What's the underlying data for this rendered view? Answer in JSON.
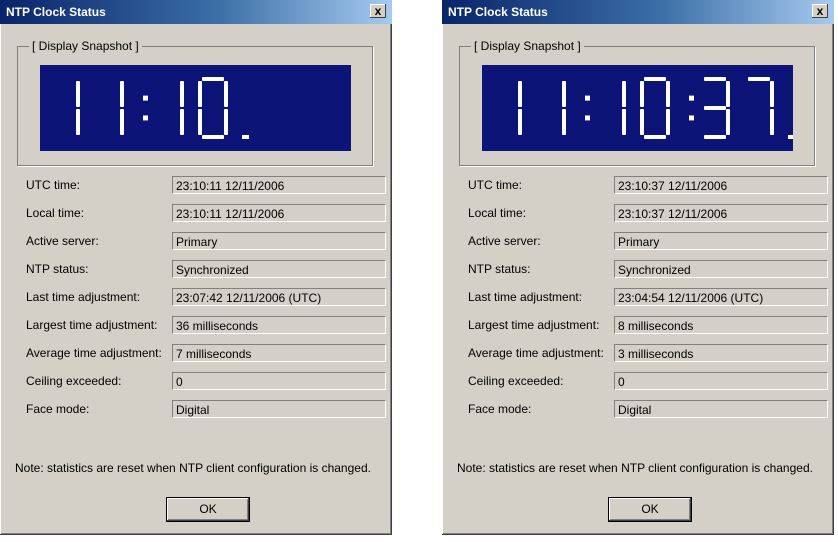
{
  "colors": {
    "display_bg": "#0c1478",
    "segment": "#ffffff",
    "title_bar": "#0a246a"
  },
  "windows": [
    {
      "title": "NTP Clock Status",
      "close_label": "x",
      "group_label": "[ Display Snapshot ]",
      "clock": {
        "hours": "11",
        "minutes": "10",
        "seconds": ""
      },
      "fields": [
        {
          "label": "UTC time:",
          "value": "23:10:11 12/11/2006"
        },
        {
          "label": "Local time:",
          "value": "23:10:11 12/11/2006"
        },
        {
          "label": "Active server:",
          "value": "Primary"
        },
        {
          "label": "NTP status:",
          "value": "Synchronized"
        },
        {
          "label": "Last time adjustment:",
          "value": "23:07:42 12/11/2006 (UTC)"
        },
        {
          "label": "Largest time adjustment:",
          "value": "36 milliseconds"
        },
        {
          "label": "Average time adjustment:",
          "value": "7 milliseconds"
        },
        {
          "label": "Ceiling exceeded:",
          "value": "0"
        },
        {
          "label": "Face mode:",
          "value": "Digital"
        }
      ],
      "note": "Note: statistics are reset when NTP client configuration is changed.",
      "ok_label": "OK"
    },
    {
      "title": "NTP Clock Status",
      "close_label": "x",
      "group_label": "[ Display Snapshot ]",
      "clock": {
        "hours": "11",
        "minutes": "10",
        "seconds": "37"
      },
      "fields": [
        {
          "label": "UTC time:",
          "value": "23:10:37 12/11/2006"
        },
        {
          "label": "Local time:",
          "value": "23:10:37 12/11/2006"
        },
        {
          "label": "Active server:",
          "value": "Primary"
        },
        {
          "label": "NTP status:",
          "value": "Synchronized"
        },
        {
          "label": "Last time adjustment:",
          "value": "23:04:54 12/11/2006 (UTC)"
        },
        {
          "label": "Largest time adjustment:",
          "value": "8 milliseconds"
        },
        {
          "label": "Average time adjustment:",
          "value": "3 milliseconds"
        },
        {
          "label": "Ceiling exceeded:",
          "value": "0"
        },
        {
          "label": "Face mode:",
          "value": "Digital"
        }
      ],
      "note": "Note: statistics are reset when NTP client configuration is changed.",
      "ok_label": "OK"
    }
  ]
}
